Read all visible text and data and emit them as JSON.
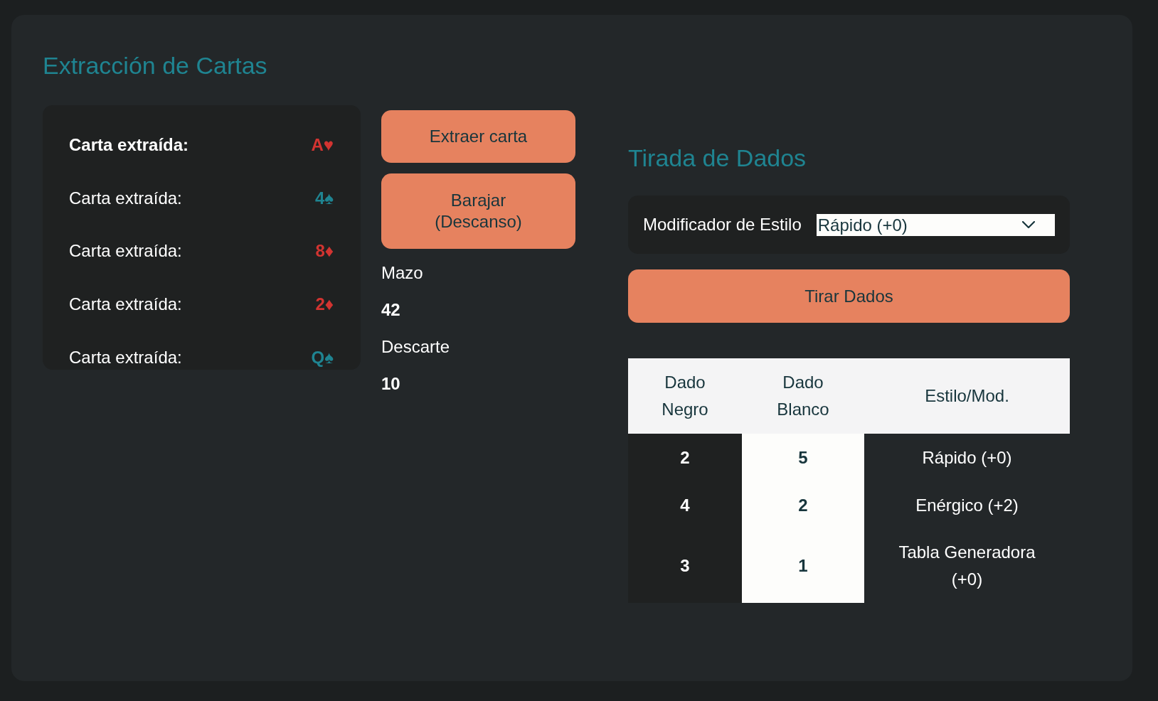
{
  "cards": {
    "title": "Extracción de Cartas",
    "draws": [
      {
        "label": "Carta extraída:",
        "card": "A♥",
        "color": "#d23431",
        "latest": true
      },
      {
        "label": "Carta extraída:",
        "card": "4♠",
        "color": "#1f8491",
        "latest": false
      },
      {
        "label": "Carta extraída:",
        "card": "8♦",
        "color": "#d23431",
        "latest": false
      },
      {
        "label": "Carta extraída:",
        "card": "2♦",
        "color": "#d23431",
        "latest": false
      },
      {
        "label": "Carta extraída:",
        "card": "Q♠",
        "color": "#1f8491",
        "latest": false
      }
    ],
    "buttons": [
      "Extraer carta",
      "Barajar (Descanso)"
    ],
    "counters": [
      {
        "label": "Mazo",
        "value": "42"
      },
      {
        "label": "Descarte",
        "value": "10"
      }
    ]
  },
  "dice": {
    "title": "Tirada de Dados",
    "modifier": {
      "label": "Modificador de Estilo",
      "value": "Rápido (+0)"
    },
    "roll_button": "Tirar Dados",
    "table": {
      "columns": [
        {
          "label": "Dado Negro",
          "kind": "black"
        },
        {
          "label": "Dado Blanco",
          "kind": "white"
        },
        {
          "label": "Estilo/Mod.",
          "kind": "plain"
        }
      ],
      "rows": [
        [
          "2",
          "5",
          "Rápido (+0)"
        ],
        [
          "4",
          "2",
          "Enérgico (+2)"
        ],
        [
          "3",
          "1",
          "Tabla Generadora (+0)"
        ]
      ]
    }
  }
}
